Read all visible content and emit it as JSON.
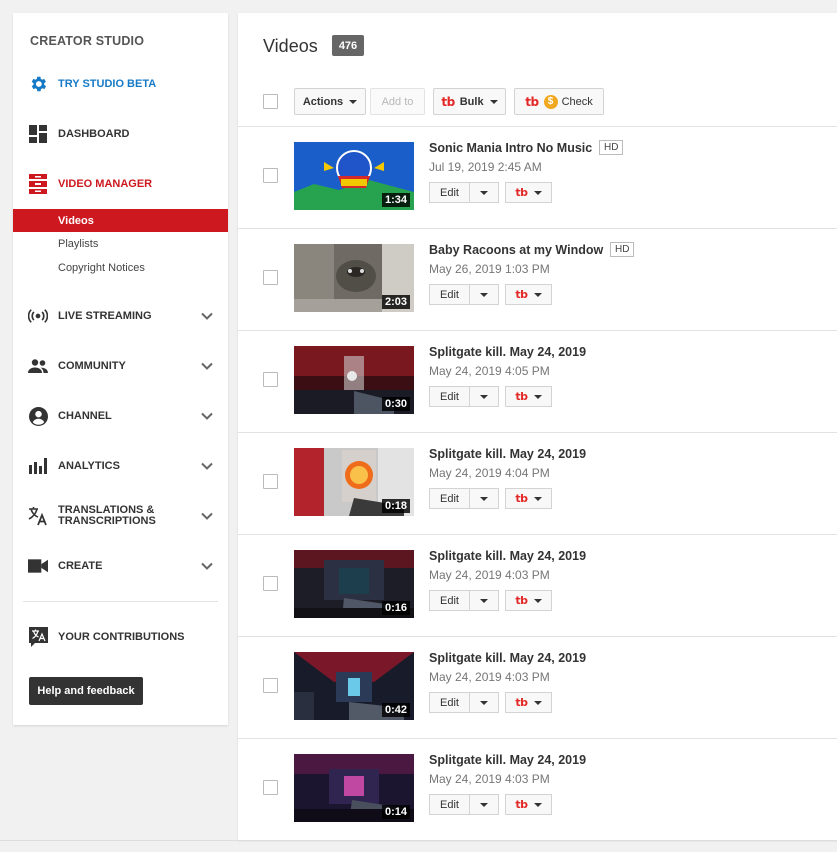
{
  "sidebar": {
    "title": "CREATOR STUDIO",
    "beta": "TRY STUDIO BETA",
    "dashboard": "DASHBOARD",
    "video_manager": "VIDEO MANAGER",
    "sub": [
      "Videos",
      "Playlists",
      "Copyright Notices"
    ],
    "live": "LIVE STREAMING",
    "community": "COMMUNITY",
    "channel": "CHANNEL",
    "analytics": "ANALYTICS",
    "translations_1": "TRANSLATIONS &",
    "translations_2": "TRANSCRIPTIONS",
    "create": "CREATE",
    "contributions": "YOUR CONTRIBUTIONS",
    "help": "Help and feedback"
  },
  "main": {
    "title": "Videos",
    "count": "476",
    "toolbar": {
      "actions": "Actions",
      "add_to": "Add to",
      "tb_logo": "tb",
      "bulk": "Bulk",
      "coin": "$",
      "check": "Check"
    },
    "edit_label": "Edit",
    "hd_label": "HD",
    "videos": [
      {
        "title": "Sonic Mania Intro No Music",
        "date": "Jul 19, 2019 2:45 AM",
        "duration": "1:34",
        "hd": true
      },
      {
        "title": "Baby Racoons at my Window",
        "date": "May 26, 2019 1:03 PM",
        "duration": "2:03",
        "hd": true
      },
      {
        "title": "Splitgate kill. May 24, 2019",
        "date": "May 24, 2019 4:05 PM",
        "duration": "0:30",
        "hd": false
      },
      {
        "title": "Splitgate kill. May 24, 2019",
        "date": "May 24, 2019 4:04 PM",
        "duration": "0:18",
        "hd": false
      },
      {
        "title": "Splitgate kill. May 24, 2019",
        "date": "May 24, 2019 4:03 PM",
        "duration": "0:16",
        "hd": false
      },
      {
        "title": "Splitgate kill. May 24, 2019",
        "date": "May 24, 2019 4:03 PM",
        "duration": "0:42",
        "hd": false
      },
      {
        "title": "Splitgate kill. May 24, 2019",
        "date": "May 24, 2019 4:03 PM",
        "duration": "0:14",
        "hd": false
      }
    ]
  },
  "colors": {
    "accent_red": "#cc181e",
    "beta_blue": "#167ac6",
    "tb_red": "#e32927"
  }
}
